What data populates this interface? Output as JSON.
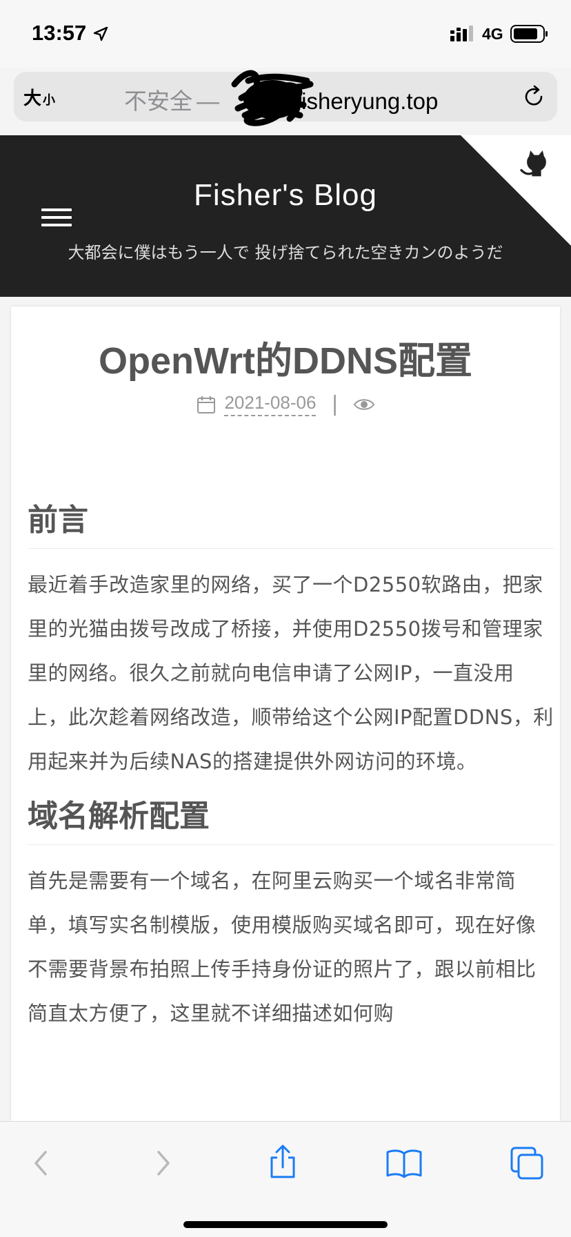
{
  "status_bar": {
    "time": "13:57",
    "network": "4G",
    "icons": [
      "location-arrow-icon",
      "signal-icon",
      "battery-icon"
    ]
  },
  "address_bar": {
    "text_size_big": "大",
    "text_size_small": "小",
    "insecure_label": "不安全",
    "separator": "—",
    "domain_visible": "fisheryung.top"
  },
  "header": {
    "title": "Fisher's Blog",
    "subtitle": "大都会に僕はもう一人で 投げ捨てられた空きカンのようだ"
  },
  "post": {
    "title": "OpenWrt的DDNS配置",
    "date": "2021-08-06",
    "sections": [
      {
        "heading": "前言",
        "paragraph": "最近着手改造家里的网络，买了一个D2550软路由，把家里的光猫由拨号改成了桥接，并使用D2550拨号和管理家里的网络。很久之前就向电信申请了公网IP，一直没用上，此次趁着网络改造，顺带给这个公网IP配置DDNS，利用起来并为后续NAS的搭建提供外网访问的环境。"
      },
      {
        "heading": "域名解析配置",
        "paragraph": "首先是需要有一个域名，在阿里云购买一个域名非常简单，填写实名制模版，使用模版购买域名即可，现在好像不需要背景布拍照上传手持身份证的照片了，跟以前相比简直太方便了，这里就不详细描述如何购"
      }
    ]
  },
  "toolbar": {
    "icons": [
      "back-icon",
      "forward-icon",
      "share-icon",
      "bookmarks-icon",
      "tabs-icon"
    ]
  }
}
